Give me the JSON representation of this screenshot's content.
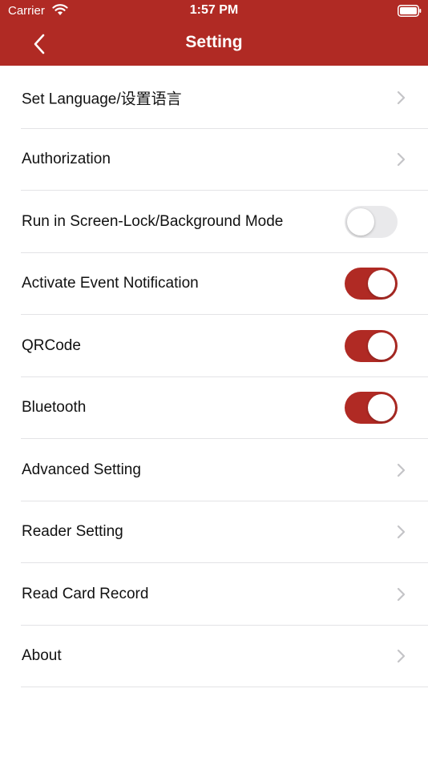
{
  "status_bar": {
    "carrier": "Carrier",
    "time": "1:57 PM"
  },
  "nav": {
    "title": "Setting",
    "back_icon": "chevron-left-icon"
  },
  "colors": {
    "accent": "#b02a24",
    "toggle_off": "#e9e9eb",
    "separator": "#e3e3e6"
  },
  "settings": [
    {
      "label": "Set Language/设置语言",
      "control": "chevron"
    },
    {
      "label": "Authorization",
      "control": "chevron"
    },
    {
      "label": "Run in Screen-Lock/Background Mode",
      "control": "toggle",
      "on": false
    },
    {
      "label": "Activate Event Notification",
      "control": "toggle",
      "on": true
    },
    {
      "label": "QRCode",
      "control": "toggle",
      "on": true
    },
    {
      "label": "Bluetooth",
      "control": "toggle",
      "on": true
    },
    {
      "label": "Advanced Setting",
      "control": "chevron"
    },
    {
      "label": "Reader Setting",
      "control": "chevron"
    },
    {
      "label": "Read Card Record",
      "control": "chevron"
    },
    {
      "label": "About",
      "control": "chevron"
    }
  ]
}
